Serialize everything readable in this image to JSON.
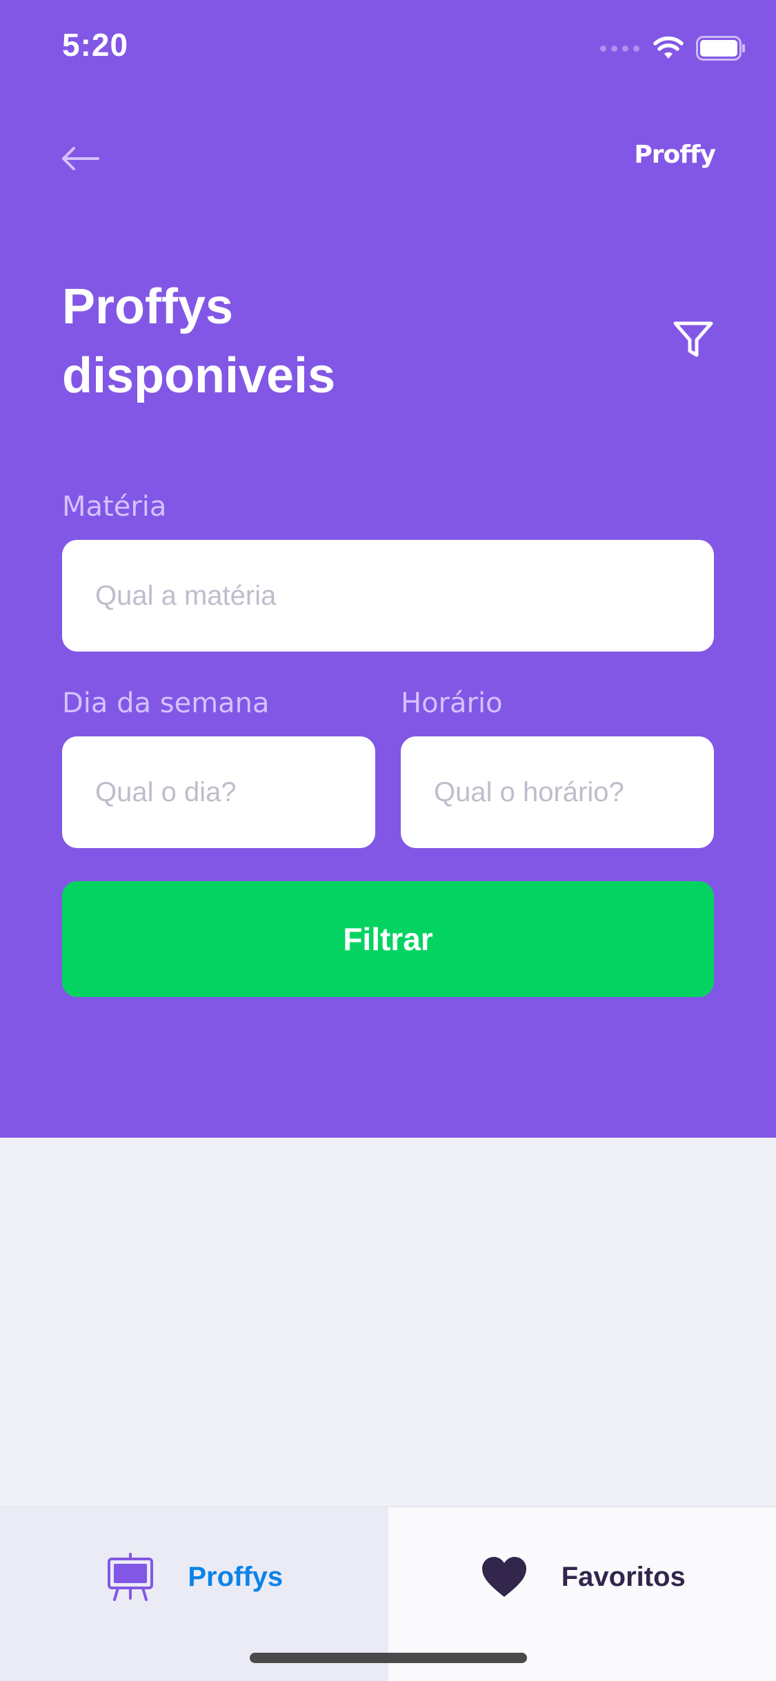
{
  "status_bar": {
    "time": "5:20",
    "signal_icon": "signal-dots-icon",
    "wifi_icon": "wifi-icon",
    "battery_icon": "battery-icon"
  },
  "header": {
    "back_icon": "arrow-left-icon",
    "logo": "Proffy",
    "title_line1": "Proffys",
    "title_line2": "disponiveis",
    "filter_icon": "filter-icon"
  },
  "form": {
    "subject_label": "Matéria",
    "subject_placeholder": "Qual a matéria",
    "day_label": "Dia da semana",
    "day_placeholder": "Qual o dia?",
    "time_label": "Horário",
    "time_placeholder": "Qual o horário?",
    "submit_label": "Filtrar"
  },
  "tabs": [
    {
      "label": "Proffys",
      "icon": "easel-icon",
      "active": true
    },
    {
      "label": "Favoritos",
      "icon": "heart-icon",
      "active": false
    }
  ],
  "colors": {
    "primary": "#8257e5",
    "background": "#f0f0f7",
    "success": "#04d361",
    "active_tab_text": "#0a84e8",
    "inactive_tab_text": "#32264d",
    "label": "#d4c2ff",
    "placeholder": "#c1bccc"
  }
}
